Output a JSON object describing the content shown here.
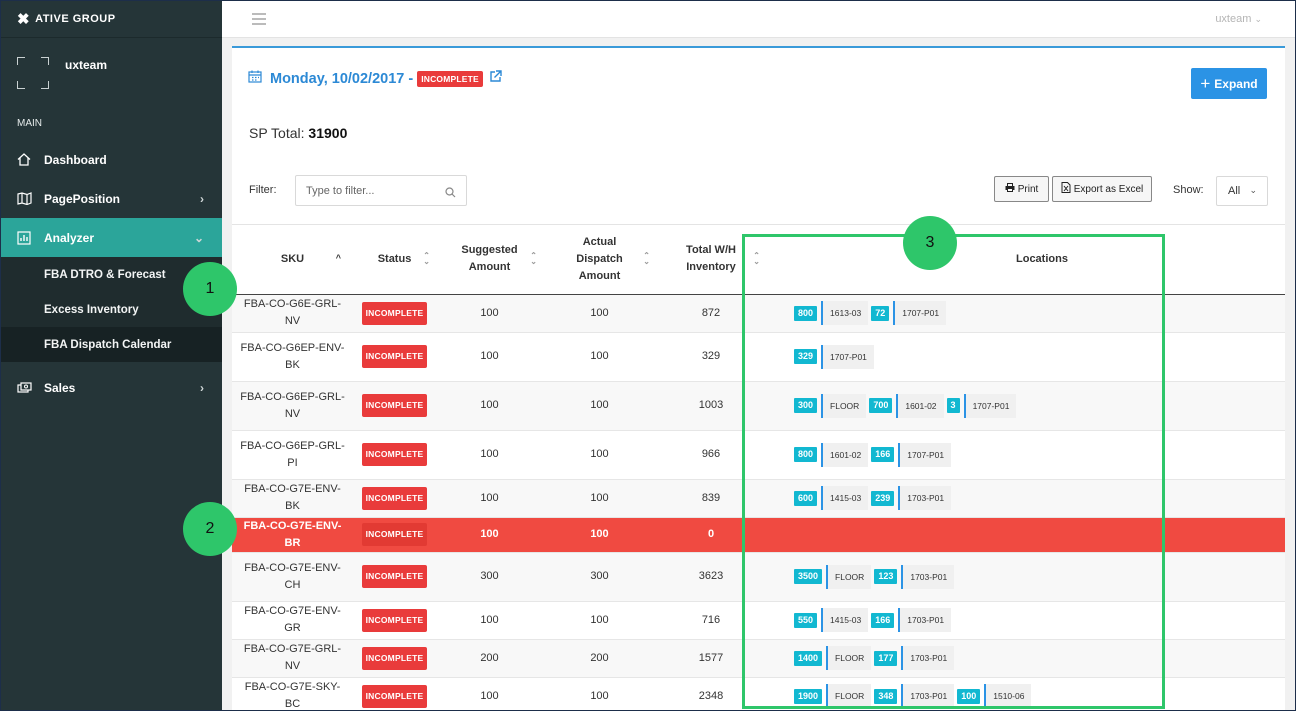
{
  "brand": {
    "logo_icon": "x-logo-icon",
    "name": "ATIVE GROUP"
  },
  "user": {
    "name": "uxteam"
  },
  "sidebar": {
    "section": "MAIN",
    "items": [
      {
        "label": "Dashboard",
        "icon": "home-icon"
      },
      {
        "label": "PagePosition",
        "icon": "map-icon"
      },
      {
        "label": "Analyzer",
        "icon": "chart-icon"
      },
      {
        "label": "Sales",
        "icon": "money-icon"
      }
    ],
    "sub_items": [
      "FBA DTRO & Forecast",
      "Excess Inventory",
      "FBA Dispatch Calendar"
    ]
  },
  "topbar": {
    "user": "uxteam",
    "user_caret": "⌄"
  },
  "page": {
    "date": "Monday, 10/02/2017 -",
    "status": "INCOMPLETE",
    "expand_label": "Expand",
    "sp_total_label": "SP Total:",
    "sp_total_value": "31900",
    "filter_label": "Filter:",
    "filter_placeholder": "Type to filter...",
    "print_label": "Print",
    "excel_label": "Export as Excel",
    "show_label": "Show:",
    "show_value": "All"
  },
  "table": {
    "headers": [
      "SKU",
      "Status",
      "Suggested Amount",
      "Actual Dispatch Amount",
      "Total W/H Inventory",
      "Locations"
    ],
    "rows": [
      {
        "sku": "FBA-CO-G6E-GRL-NV",
        "status": "INCOMPLETE",
        "suggested": "100",
        "actual": "100",
        "inventory": "872",
        "locations": [
          [
            "800",
            "1613-03"
          ],
          [
            "72",
            "1707-P01"
          ]
        ]
      },
      {
        "sku": "FBA-CO-G6EP-ENV-BK",
        "status": "INCOMPLETE",
        "suggested": "100",
        "actual": "100",
        "inventory": "329",
        "locations": [
          [
            "329",
            "1707-P01"
          ]
        ]
      },
      {
        "sku": "FBA-CO-G6EP-GRL-NV",
        "status": "INCOMPLETE",
        "suggested": "100",
        "actual": "100",
        "inventory": "1003",
        "locations": [
          [
            "300",
            "FLOOR"
          ],
          [
            "700",
            "1601-02"
          ],
          [
            "3",
            "1707-P01"
          ]
        ]
      },
      {
        "sku": "FBA-CO-G6EP-GRL-PI",
        "status": "INCOMPLETE",
        "suggested": "100",
        "actual": "100",
        "inventory": "966",
        "locations": [
          [
            "800",
            "1601-02"
          ],
          [
            "166",
            "1707-P01"
          ]
        ]
      },
      {
        "sku": "FBA-CO-G7E-ENV-BK",
        "status": "INCOMPLETE",
        "suggested": "100",
        "actual": "100",
        "inventory": "839",
        "locations": [
          [
            "600",
            "1415-03"
          ],
          [
            "239",
            "1703-P01"
          ]
        ]
      },
      {
        "sku": "FBA-CO-G7E-ENV-BR",
        "status": "INCOMPLETE",
        "suggested": "100",
        "actual": "100",
        "inventory": "0",
        "locations": [],
        "highlight": true
      },
      {
        "sku": "FBA-CO-G7E-ENV-CH",
        "status": "INCOMPLETE",
        "suggested": "300",
        "actual": "300",
        "inventory": "3623",
        "locations": [
          [
            "3500",
            "FLOOR"
          ],
          [
            "123",
            "1703-P01"
          ]
        ]
      },
      {
        "sku": "FBA-CO-G7E-ENV-GR",
        "status": "INCOMPLETE",
        "suggested": "100",
        "actual": "100",
        "inventory": "716",
        "locations": [
          [
            "550",
            "1415-03"
          ],
          [
            "166",
            "1703-P01"
          ]
        ]
      },
      {
        "sku": "FBA-CO-G7E-GRL-NV",
        "status": "INCOMPLETE",
        "suggested": "200",
        "actual": "200",
        "inventory": "1577",
        "locations": [
          [
            "1400",
            "FLOOR"
          ],
          [
            "177",
            "1703-P01"
          ]
        ]
      },
      {
        "sku": "FBA-CO-G7E-SKY-BC",
        "status": "INCOMPLETE",
        "suggested": "100",
        "actual": "100",
        "inventory": "2348",
        "locations": [
          [
            "1900",
            "FLOOR"
          ],
          [
            "348",
            "1703-P01"
          ],
          [
            "100",
            "1510-06"
          ]
        ]
      }
    ]
  },
  "callouts": [
    "1",
    "2",
    "3"
  ],
  "colors": {
    "accent": "#2ba59a",
    "incomplete": "#e93b3b",
    "highlight_row": "#f04a41",
    "qty_chip": "#12b8d1",
    "callout": "#2ec66a",
    "link": "#2c89d5"
  }
}
